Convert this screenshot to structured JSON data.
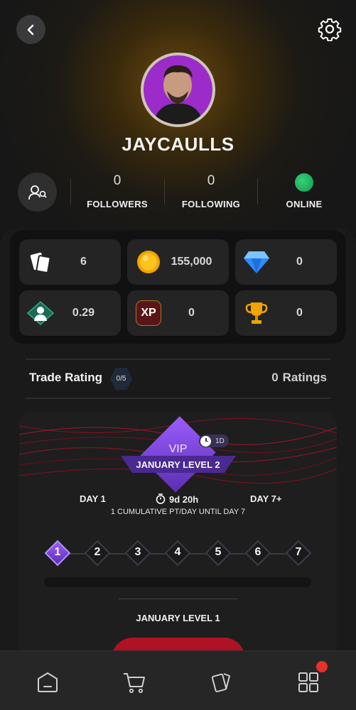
{
  "header": {
    "back_icon": "chevron-left-icon",
    "settings_icon": "gear-icon"
  },
  "profile": {
    "username": "JAYCAULLS",
    "avatar_color": "#9b2cc9",
    "followers_count": "0",
    "followers_label": "FOLLOWERS",
    "following_count": "0",
    "following_label": "FOLLOWING",
    "status_label": "ONLINE",
    "status_color": "#25c466"
  },
  "stats": {
    "cards": "6",
    "coins": "155,000",
    "gems": "0",
    "rating": "0.29",
    "xp_label": "XP",
    "xp": "0",
    "trophies": "0"
  },
  "trade": {
    "label": "Trade Rating",
    "badge": "0/5",
    "ratings_count": "0",
    "ratings_label": "Ratings"
  },
  "vip": {
    "title": "VIP",
    "level": "JANUARY LEVEL 2",
    "time_left_badge": "1D",
    "day_start": "DAY 1",
    "countdown": "9d 20h",
    "day_end": "DAY 7+",
    "description": "1 CUMULATIVE PT/DAY UNTIL DAY 7",
    "steps": [
      "1",
      "2",
      "3",
      "4",
      "5",
      "6",
      "7"
    ],
    "current_step": 1,
    "next_level": "JANUARY LEVEL 1"
  },
  "nav": {
    "items": [
      "home-icon",
      "cart-icon",
      "cards-icon",
      "grid-icon"
    ],
    "notification_color": "#e8302a"
  }
}
